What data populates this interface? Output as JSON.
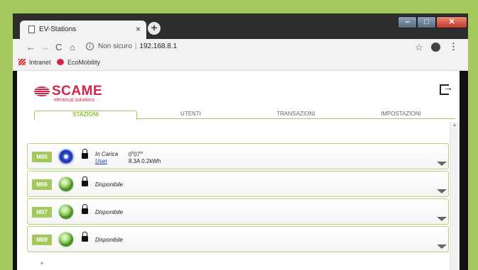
{
  "browser": {
    "tab_title": "EV-Stations",
    "tab_close": "×",
    "new_tab": "+",
    "window_controls": {
      "minimize": "–",
      "maximize": "□",
      "close": "✕"
    },
    "nav": {
      "back": "←",
      "forward": "→",
      "reload": "C",
      "home": "⌂"
    },
    "security_label": "Non sicuro",
    "url": "192.168.8.1",
    "bookmark_star": "☆",
    "menu": "⋮",
    "bookmarks": [
      {
        "label": "Intranet"
      },
      {
        "label": "EcoMobility"
      }
    ]
  },
  "app": {
    "logo_text": "SCAME",
    "logo_sub": "electrical solutions",
    "tabs": [
      {
        "label": "STAZIONI"
      },
      {
        "label": "UTENTI"
      },
      {
        "label": "TRANSAZIONI"
      },
      {
        "label": "IMPOSTAZIONI"
      }
    ],
    "stations": [
      {
        "id": "M05",
        "status": "In Carica",
        "user": "User",
        "time_hours": "0",
        "time_minutes": "07",
        "measurements": "8.3A 0.2kWh",
        "led_icon": "charging-led-icon"
      },
      {
        "id": "M06",
        "status": "Disponibile",
        "led_icon": "available-led-icon"
      },
      {
        "id": "M07",
        "status": "Disponibile",
        "led_icon": "available-led-icon"
      },
      {
        "id": "M08",
        "status": "Disponibile",
        "led_icon": "available-led-icon"
      }
    ],
    "add_label": "+",
    "colors": {
      "accent": "#a3c95c",
      "brand": "#d6234a",
      "charging": "#3856d6"
    }
  }
}
